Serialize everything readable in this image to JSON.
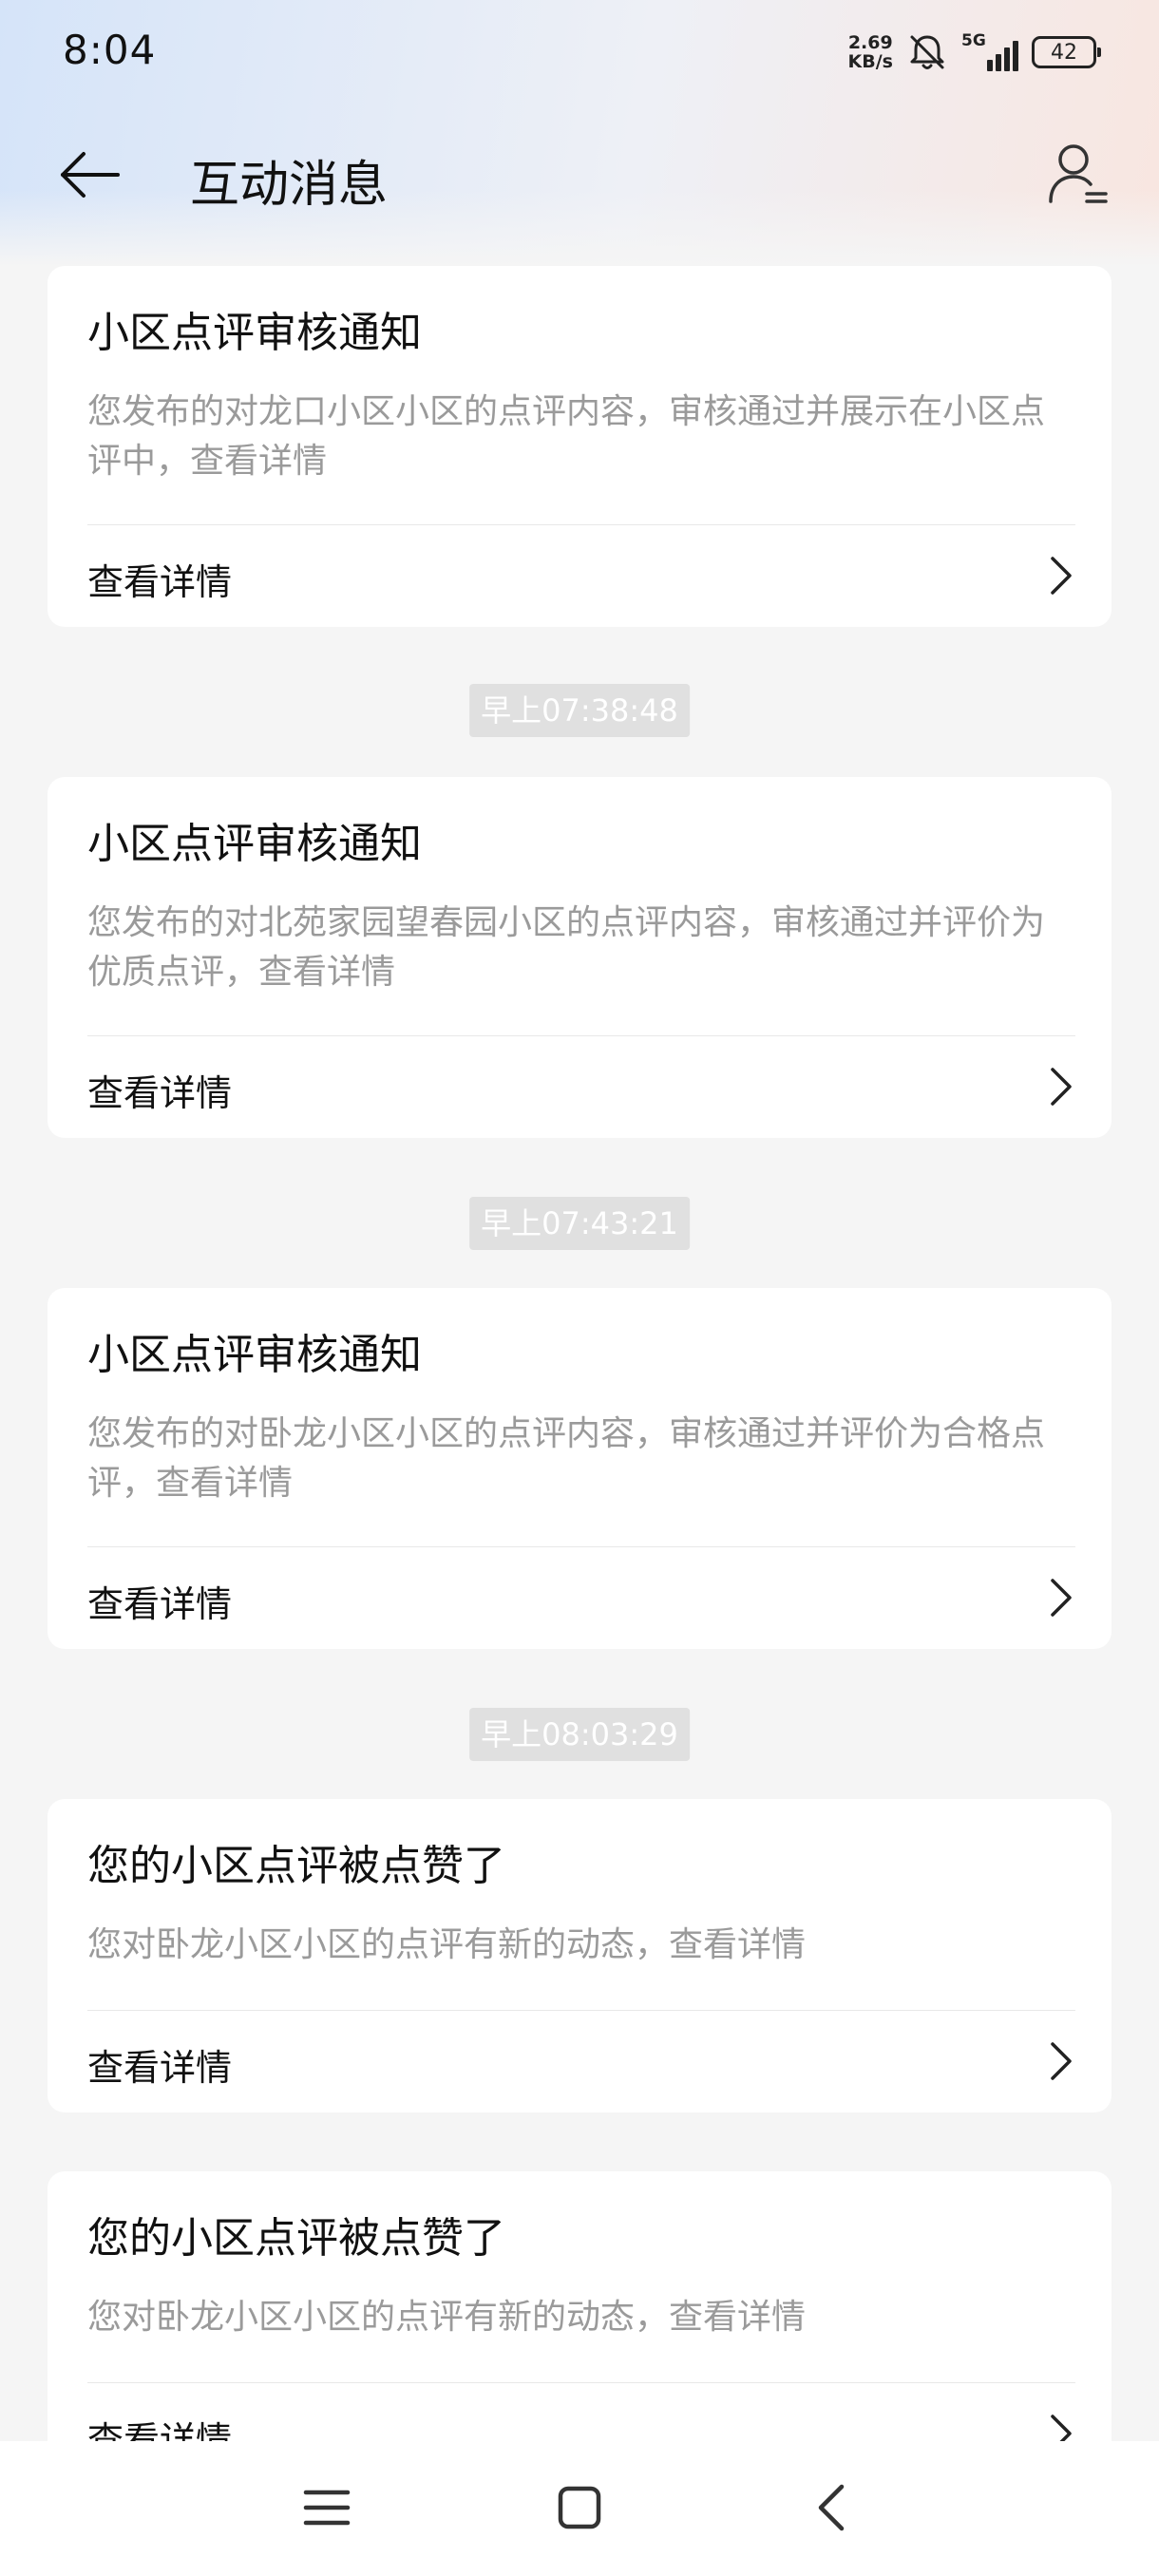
{
  "status_bar": {
    "time": "8:04",
    "net_speed_value": "2.69",
    "net_speed_unit": "KB/s",
    "network_type": "5G",
    "battery_level": "42"
  },
  "header": {
    "title": "互动消息"
  },
  "cards": [
    {
      "title": "小区点评审核通知",
      "desc": "您发布的对龙口小区小区的点评内容，审核通过并展示在小区点评中，查看详情",
      "action": "查看详情"
    },
    {
      "title": "小区点评审核通知",
      "desc": "您发布的对北苑家园望春园小区的点评内容，审核通过并评价为优质点评，查看详情",
      "action": "查看详情"
    },
    {
      "title": "小区点评审核通知",
      "desc": "您发布的对卧龙小区小区的点评内容，审核通过并评价为合格点评，查看详情",
      "action": "查看详情"
    },
    {
      "title": "您的小区点评被点赞了",
      "desc": "您对卧龙小区小区的点评有新的动态，查看详情",
      "action": "查看详情"
    },
    {
      "title": "您的小区点评被点赞了",
      "desc": "您对卧龙小区小区的点评有新的动态，查看详情",
      "action": "查看详情"
    }
  ],
  "timestamps": [
    "早上07:38:48",
    "早上07:43:21",
    "早上08:03:29"
  ],
  "nav_bar": {
    "icons": [
      "menu-icon",
      "home-icon",
      "back-icon"
    ]
  }
}
